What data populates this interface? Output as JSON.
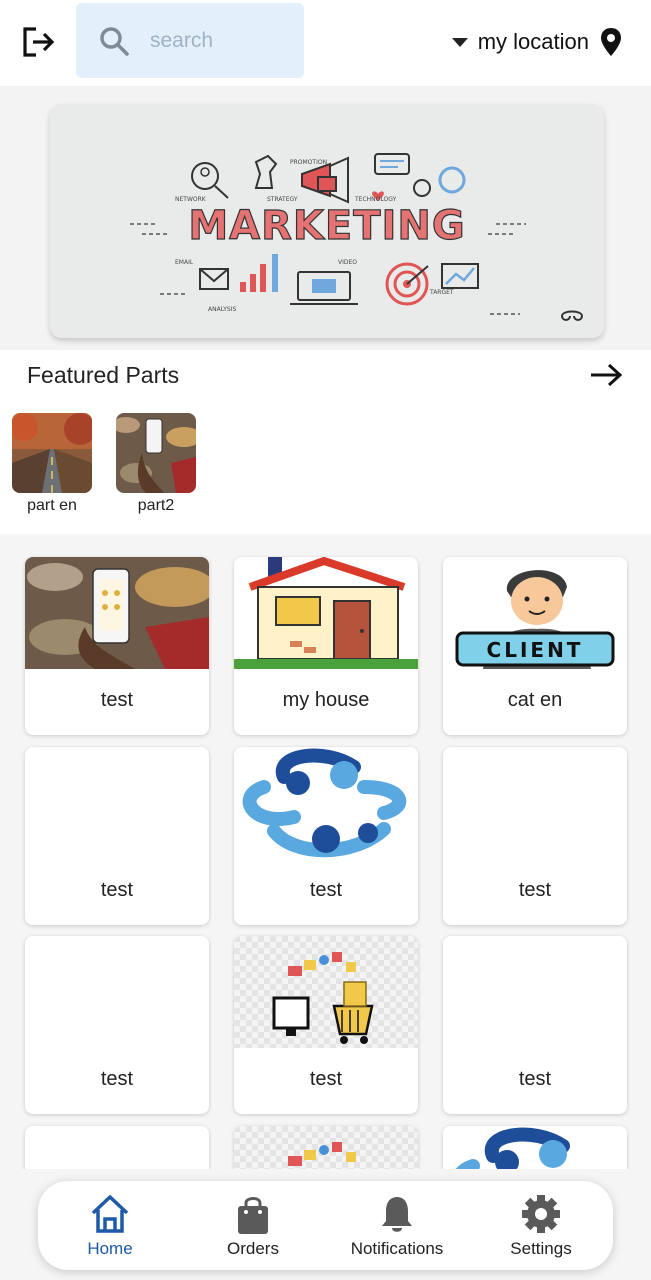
{
  "header": {
    "search_placeholder": "search",
    "location_label": "my location"
  },
  "banner": {
    "heading": "MARKETING",
    "labels": [
      "PROMOTION",
      "NETWORK",
      "STRATEGY",
      "TECHNOLOGY",
      "EMAIL",
      "VIDEO",
      "TARGET",
      "ANALYSIS"
    ]
  },
  "featured": {
    "title": "Featured Parts",
    "parts": [
      {
        "label": "part en"
      },
      {
        "label": "part2"
      }
    ]
  },
  "categories": [
    {
      "label": "test"
    },
    {
      "label": "my house"
    },
    {
      "label": "cat en"
    },
    {
      "label": "test"
    },
    {
      "label": "test"
    },
    {
      "label": "test"
    },
    {
      "label": "test"
    },
    {
      "label": "test"
    },
    {
      "label": "test"
    }
  ],
  "client_badge": "CLIENT",
  "nav": {
    "items": [
      {
        "label": "Home",
        "icon": "home-icon"
      },
      {
        "label": "Orders",
        "icon": "shopping-bag-icon"
      },
      {
        "label": "Notifications",
        "icon": "bell-icon"
      },
      {
        "label": "Settings",
        "icon": "gear-icon"
      }
    ],
    "active_color": "#1e5aa8"
  }
}
